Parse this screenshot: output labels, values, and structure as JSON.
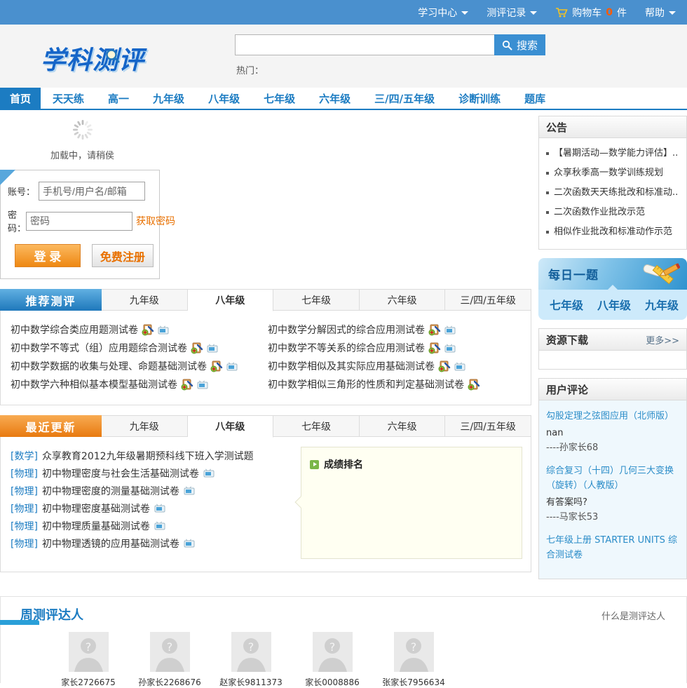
{
  "topbar": {
    "learning_center": "学习中心",
    "record": "测评记录",
    "cart_label": "购物车",
    "cart_count": "0",
    "cart_suffix": "件",
    "help": "帮助"
  },
  "header": {
    "logo": "学科测评",
    "search_button": "搜索",
    "hot_label": "热门："
  },
  "nav": {
    "items": [
      "首页",
      "天天练",
      "高一",
      "九年级",
      "八年级",
      "七年级",
      "六年级",
      "三/四/五年级",
      "诊断训练",
      "题库"
    ],
    "active": "首页"
  },
  "loading": {
    "text": "加载中，请稍侯"
  },
  "login": {
    "account_label": "账号：",
    "account_placeholder": "手机号/用户名/邮箱",
    "password_label": "密码：",
    "password_placeholder": "密码",
    "get_password": "获取密码",
    "login_button": "登 录",
    "register_button": "免费注册"
  },
  "recommended": {
    "title": "推荐测评",
    "tabs": [
      "九年级",
      "八年级",
      "七年级",
      "六年级",
      "三/四/五年级"
    ],
    "active_tab": "八年级",
    "left": [
      {
        "title": "初中数学综合类应用题测试卷"
      },
      {
        "title": "初中数学不等式（组）应用题综合测试卷"
      },
      {
        "title": "初中数学数据的收集与处理、命题基础测试卷"
      },
      {
        "title": "初中数学六种相似基本模型基础测试卷"
      }
    ],
    "right": [
      {
        "title": "初中数学分解因式的综合应用测试卷"
      },
      {
        "title": "初中数学不等关系的综合应用测试卷"
      },
      {
        "title": "初中数学相似及其实际应用基础测试卷"
      },
      {
        "title": "初中数学相似三角形的性质和判定基础测试卷"
      }
    ]
  },
  "recent": {
    "title": "最近更新",
    "tabs": [
      "九年级",
      "八年级",
      "七年级",
      "六年级",
      "三/四/五年级"
    ],
    "active_tab": "八年级",
    "items": [
      {
        "tag": "[数学]",
        "title": "众享教育2012九年级暑期预科线下班入学测试题"
      },
      {
        "tag": "[物理]",
        "title": "初中物理密度与社会生活基础测试卷"
      },
      {
        "tag": "[物理]",
        "title": "初中物理密度的测量基础测试卷"
      },
      {
        "tag": "[物理]",
        "title": "初中物理密度基础测试卷"
      },
      {
        "tag": "[物理]",
        "title": "初中物理质量基础测试卷"
      },
      {
        "tag": "[物理]",
        "title": "初中物理透镜的应用基础测试卷"
      }
    ]
  },
  "ranking": {
    "title": "成绩排名"
  },
  "masters": {
    "title": "周测评达人",
    "link": "什么是测评达人",
    "users": [
      "家长2726675",
      "孙家长2268676",
      "赵家长9811373",
      "家长0008886",
      "张家长7956634"
    ]
  },
  "announcements": {
    "title": "公告",
    "items": [
      "【暑期活动—数学能力评估】..",
      "众享秋季高一数学训练规划",
      "二次函数天天练批改和标准动..",
      "二次函数作业批改示范",
      "相似作业批改和标准动作示范"
    ]
  },
  "daily": {
    "title": "每日一题",
    "tabs": [
      "七年级",
      "八年级",
      "九年级"
    ]
  },
  "resources": {
    "title": "资源下载",
    "more": "更多>>"
  },
  "comments": {
    "title": "用户评论",
    "items": [
      {
        "link": "勾股定理之弦图应用（北师版）",
        "text": "nan",
        "author": "----孙家长68"
      },
      {
        "link": "综合复习（十四）几何三大变换（旋转）（人教版）",
        "text": "有答案吗?",
        "author": "----马家长53"
      },
      {
        "link": "七年级上册 STARTER UNITS 综合测试卷",
        "text": "",
        "author": ""
      }
    ]
  },
  "colors": {
    "topbar_blue": "#4a90ce",
    "nav_blue": "#1c7cc2",
    "accent_orange": "#e87000",
    "recent_orange": "#e87a10"
  }
}
